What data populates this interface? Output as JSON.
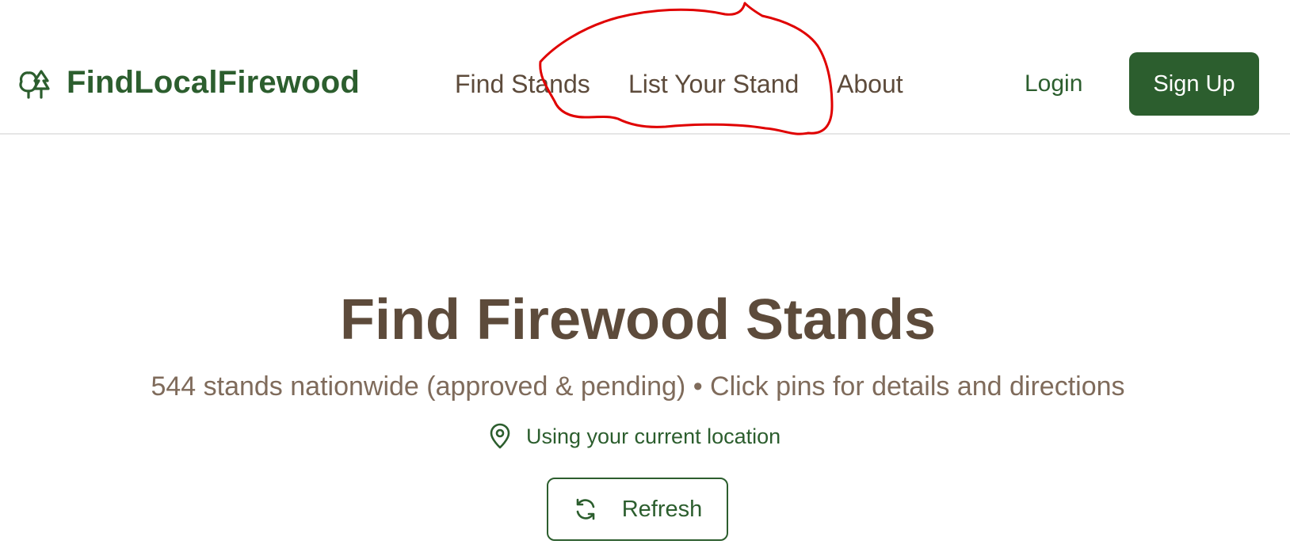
{
  "header": {
    "brand_name": "FindLocalFirewood",
    "brand_icon": "trees-icon",
    "nav": {
      "find_stands": "Find Stands",
      "list_your_stand": "List Your Stand",
      "about": "About"
    },
    "login_label": "Login",
    "signup_label": "Sign Up"
  },
  "hero": {
    "title": "Find Firewood Stands",
    "subtitle": "544 stands nationwide (approved & pending) • Click pins for details and directions",
    "location_icon": "map-pin-icon",
    "location_text": "Using your current location",
    "refresh_icon": "refresh-icon",
    "refresh_label": "Refresh"
  },
  "colors": {
    "brand_green": "#2c5e2e",
    "text_brown": "#5d4b3b",
    "subtitle_brown": "#7f6b5b",
    "annotation_red": "#e00000"
  }
}
